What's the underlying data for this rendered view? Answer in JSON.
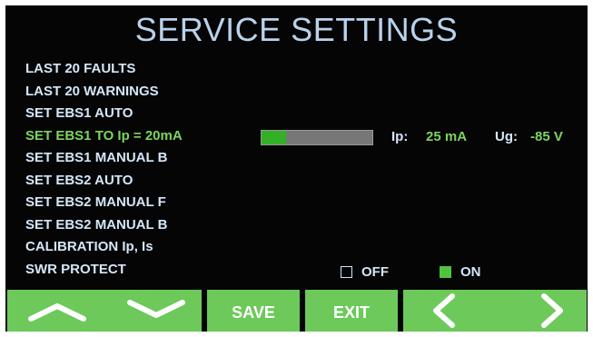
{
  "screen": {
    "title": "SERVICE SETTINGS"
  },
  "menu": {
    "items": [
      {
        "label": "LAST 20 FAULTS",
        "selected": false
      },
      {
        "label": "LAST 20 WARNINGS",
        "selected": false
      },
      {
        "label": "SET EBS1 AUTO",
        "selected": false
      },
      {
        "label": "SET EBS1 TO Ip = 20mA",
        "selected": true
      },
      {
        "label": "SET EBS1 MANUAL B",
        "selected": false
      },
      {
        "label": "SET EBS2 AUTO",
        "selected": false
      },
      {
        "label": "SET EBS2 MANUAL F",
        "selected": false
      },
      {
        "label": "SET EBS2 MANUAL B",
        "selected": false
      },
      {
        "label": "CALIBRATION Ip, Is",
        "selected": false
      },
      {
        "label": "SWR PROTECT",
        "selected": false
      }
    ]
  },
  "status": {
    "bar_level": 0.22,
    "ip_label": "Ip:",
    "ip_value": "25 mA",
    "ug_label": "Ug:",
    "ug_value": "-85 V"
  },
  "swr": {
    "off_label": "OFF",
    "on_label": "ON",
    "selected": "ON"
  },
  "buttons": {
    "up_icon": "chevron-up-icon",
    "down_icon": "chevron-down-icon",
    "save_label": "SAVE",
    "exit_label": "EXIT",
    "left_icon": "chevron-left-icon",
    "right_icon": "chevron-right-icon"
  },
  "colors": {
    "background": "#050505",
    "text": "#d4e6f8",
    "title": "#b9d2ec",
    "accent": "#7dd460",
    "button": "#6cc95a"
  }
}
